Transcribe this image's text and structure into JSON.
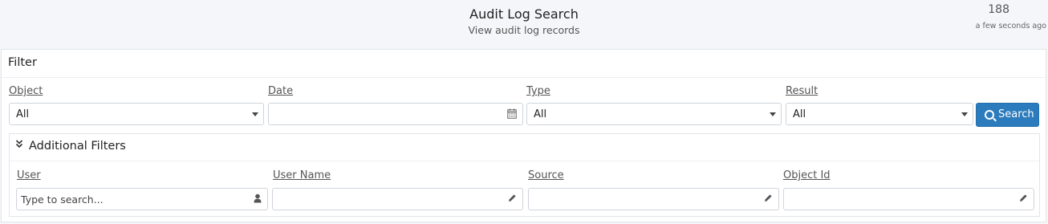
{
  "header": {
    "title": "Audit Log Search",
    "subtitle": "View audit log records",
    "count": "188",
    "updated": "a few seconds ago"
  },
  "filter": {
    "title": "Filter",
    "object": {
      "label": "Object",
      "value": "All"
    },
    "date": {
      "label": "Date",
      "value": ""
    },
    "type": {
      "label": "Type",
      "value": "All"
    },
    "result": {
      "label": "Result",
      "value": "All"
    },
    "search_label": "Search"
  },
  "additional": {
    "title": "Additional Filters",
    "user": {
      "label": "User",
      "placeholder": "Type to search..."
    },
    "user_name": {
      "label": "User Name",
      "value": ""
    },
    "source": {
      "label": "Source",
      "value": ""
    },
    "object_id": {
      "label": "Object Id",
      "value": ""
    }
  },
  "icons": {
    "calendar": "calendar-icon",
    "user": "user-icon",
    "pencil": "pencil-icon",
    "search": "search-icon",
    "chevron": "chevron-double-down-icon"
  },
  "colors": {
    "accent": "#2b7bbd",
    "background": "#f4f6f9"
  }
}
